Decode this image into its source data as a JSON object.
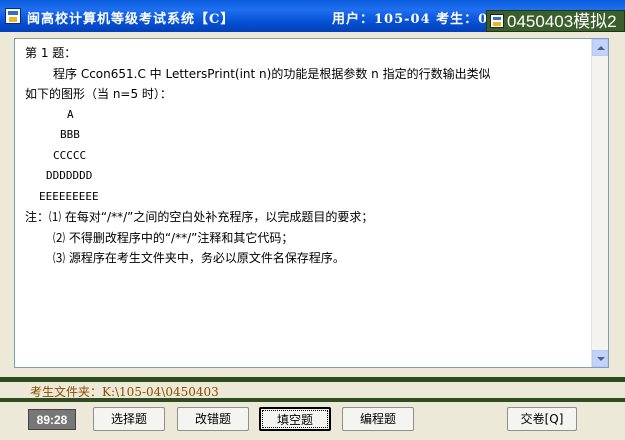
{
  "window": {
    "title": "闽高校计算机等级考试系统【C】",
    "user_info": "用户：105-04 考生：0"
  },
  "floating_window": {
    "label": "0450403模拟2"
  },
  "question": {
    "heading": "第 1 题：",
    "line1": "程序 Ccon651.C 中 LettersPrint(int n)的功能是根据参数 n 指定的行数输出类似",
    "line2": "如下的图形（当 n=5 时）：",
    "pattern": [
      "A",
      "BBB",
      "CCCCC",
      "DDDDDDD",
      "EEEEEEEEE"
    ],
    "note1": "注：⑴ 在每对“/**/”之间的空白处补充程序，以完成题目的要求；",
    "note2": "⑵ 不得删改程序中的“/**/”注释和其它代码；",
    "note3": "⑶ 源程序在考生文件夹中，务必以原文件名保存程序。"
  },
  "status": {
    "path": "考生文件夹：K:\\105-04\\0450403"
  },
  "toolbar": {
    "timer": "89:28",
    "choice_label": "选择题",
    "fix_label": "改错题",
    "fill_label": "填空题",
    "program_label": "编程题",
    "submit_label": "交卷[Q]"
  },
  "colors": {
    "titlebar": "#0650d4",
    "status_path": "#8b4c00",
    "divider": "#2e4c20"
  },
  "icons": [
    "app-icon",
    "scroll-up-icon",
    "scroll-down-icon"
  ]
}
